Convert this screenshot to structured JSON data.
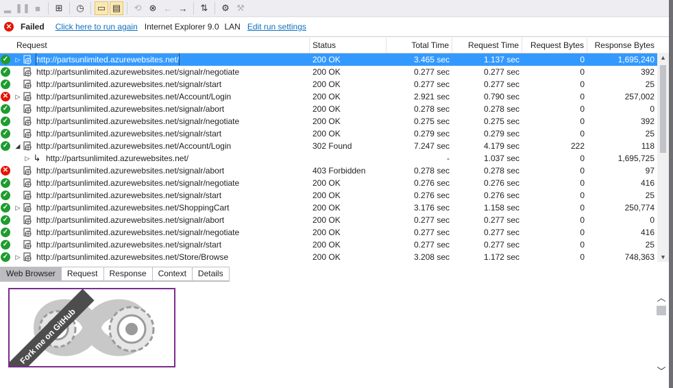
{
  "toolbar": {
    "icons": [
      "bars-icon",
      "pause-icon",
      "stop-icon",
      "sep",
      "add-request-icon",
      "sep",
      "timer-icon",
      "sep",
      "folder-icon",
      "panel-icon",
      "sep",
      "find-icon",
      "clear-icon",
      "back-icon",
      "forward-icon",
      "sep",
      "network-icon",
      "sep",
      "run-icon",
      "settings-icon"
    ]
  },
  "status": {
    "result": "Failed",
    "run_again": "Click here to run again",
    "browser": "Internet Explorer 9.0",
    "network": "LAN",
    "edit_settings": "Edit run settings"
  },
  "columns": {
    "request": "Request",
    "status": "Status",
    "total_time": "Total Time",
    "request_time": "Request Time",
    "request_bytes": "Request Bytes",
    "response_bytes": "Response Bytes"
  },
  "rows": [
    {
      "ok": "ok",
      "exp": "right",
      "indent": false,
      "url": "http://partsunlimited.azurewebsites.net/",
      "status": "200 OK",
      "total": "3.465 sec",
      "rtime": "1.137 sec",
      "rbytes": "0",
      "respb": "1,695,240",
      "selected": true
    },
    {
      "ok": "ok",
      "exp": "",
      "indent": false,
      "url": "http://partsunlimited.azurewebsites.net/signalr/negotiate",
      "status": "200 OK",
      "total": "0.277 sec",
      "rtime": "0.277 sec",
      "rbytes": "0",
      "respb": "392"
    },
    {
      "ok": "ok",
      "exp": "",
      "indent": false,
      "url": "http://partsunlimited.azurewebsites.net/signalr/start",
      "status": "200 OK",
      "total": "0.277 sec",
      "rtime": "0.277 sec",
      "rbytes": "0",
      "respb": "25"
    },
    {
      "ok": "fail",
      "exp": "right",
      "indent": false,
      "url": "http://partsunlimited.azurewebsites.net/Account/Login",
      "status": "200 OK",
      "total": "2.921 sec",
      "rtime": "0.790 sec",
      "rbytes": "0",
      "respb": "257,002"
    },
    {
      "ok": "ok",
      "exp": "",
      "indent": false,
      "url": "http://partsunlimited.azurewebsites.net/signalr/abort",
      "status": "200 OK",
      "total": "0.278 sec",
      "rtime": "0.278 sec",
      "rbytes": "0",
      "respb": "0"
    },
    {
      "ok": "ok",
      "exp": "",
      "indent": false,
      "url": "http://partsunlimited.azurewebsites.net/signalr/negotiate",
      "status": "200 OK",
      "total": "0.275 sec",
      "rtime": "0.275 sec",
      "rbytes": "0",
      "respb": "392"
    },
    {
      "ok": "ok",
      "exp": "",
      "indent": false,
      "url": "http://partsunlimited.azurewebsites.net/signalr/start",
      "status": "200 OK",
      "total": "0.279 sec",
      "rtime": "0.279 sec",
      "rbytes": "0",
      "respb": "25"
    },
    {
      "ok": "ok",
      "exp": "down",
      "indent": false,
      "url": "http://partsunlimited.azurewebsites.net/Account/Login",
      "status": "302 Found",
      "total": "7.247 sec",
      "rtime": "4.179 sec",
      "rbytes": "222",
      "respb": "118"
    },
    {
      "ok": "none",
      "exp": "right",
      "indent": true,
      "url": "http://partsunlimited.azurewebsites.net/",
      "status": "",
      "total": "-",
      "rtime": "1.037 sec",
      "rbytes": "0",
      "respb": "1,695,725"
    },
    {
      "ok": "fail",
      "exp": "",
      "indent": false,
      "url": "http://partsunlimited.azurewebsites.net/signalr/abort",
      "status": "403 Forbidden",
      "total": "0.278 sec",
      "rtime": "0.278 sec",
      "rbytes": "0",
      "respb": "97"
    },
    {
      "ok": "ok",
      "exp": "",
      "indent": false,
      "url": "http://partsunlimited.azurewebsites.net/signalr/negotiate",
      "status": "200 OK",
      "total": "0.276 sec",
      "rtime": "0.276 sec",
      "rbytes": "0",
      "respb": "416"
    },
    {
      "ok": "ok",
      "exp": "",
      "indent": false,
      "url": "http://partsunlimited.azurewebsites.net/signalr/start",
      "status": "200 OK",
      "total": "0.276 sec",
      "rtime": "0.276 sec",
      "rbytes": "0",
      "respb": "25"
    },
    {
      "ok": "ok",
      "exp": "right",
      "indent": false,
      "url": "http://partsunlimited.azurewebsites.net/ShoppingCart",
      "status": "200 OK",
      "total": "3.176 sec",
      "rtime": "1.158 sec",
      "rbytes": "0",
      "respb": "250,774"
    },
    {
      "ok": "ok",
      "exp": "",
      "indent": false,
      "url": "http://partsunlimited.azurewebsites.net/signalr/abort",
      "status": "200 OK",
      "total": "0.277 sec",
      "rtime": "0.277 sec",
      "rbytes": "0",
      "respb": "0"
    },
    {
      "ok": "ok",
      "exp": "",
      "indent": false,
      "url": "http://partsunlimited.azurewebsites.net/signalr/negotiate",
      "status": "200 OK",
      "total": "0.277 sec",
      "rtime": "0.277 sec",
      "rbytes": "0",
      "respb": "416"
    },
    {
      "ok": "ok",
      "exp": "",
      "indent": false,
      "url": "http://partsunlimited.azurewebsites.net/signalr/start",
      "status": "200 OK",
      "total": "0.277 sec",
      "rtime": "0.277 sec",
      "rbytes": "0",
      "respb": "25"
    },
    {
      "ok": "ok",
      "exp": "right",
      "indent": false,
      "url": "http://partsunlimited.azurewebsites.net/Store/Browse",
      "status": "200 OK",
      "total": "3.208 sec",
      "rtime": "1.172 sec",
      "rbytes": "0",
      "respb": "748,363"
    }
  ],
  "tabs": [
    {
      "label": "Web Browser",
      "active": true
    },
    {
      "label": "Request"
    },
    {
      "label": "Response"
    },
    {
      "label": "Context"
    },
    {
      "label": "Details"
    }
  ],
  "preview": {
    "ribbon_text": "Fork me on GitHub"
  }
}
